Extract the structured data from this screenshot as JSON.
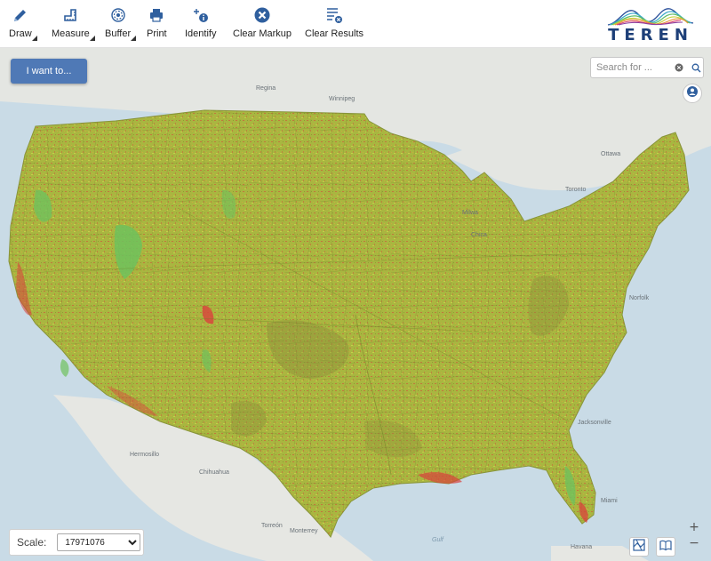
{
  "toolbar": {
    "draw": "Draw",
    "measure": "Measure",
    "buffer": "Buffer",
    "print": "Print",
    "identify": "Identify",
    "clear_markup": "Clear Markup",
    "clear_results": "Clear Results"
  },
  "logo": {
    "text": "TEREN"
  },
  "i_want_to": "I want to...",
  "search": {
    "placeholder": "Search for ..."
  },
  "scale": {
    "label": "Scale:",
    "value": "17971076"
  },
  "zoom": {
    "in": "+",
    "out": "−"
  },
  "map_labels": {
    "regina": "Regina",
    "winnipeg": "Winnipeg",
    "ottawa": "Ottawa",
    "toronto": "Toronto",
    "milwaukee": "Milwa",
    "chicago": "Chica",
    "norfolk": "Norfolk",
    "jacksonville": "Jacksonville",
    "miami": "Miami",
    "hermosillo": "Hermosillo",
    "chihuahua": "Chihuahua",
    "torreon": "Torreón",
    "monterrey": "Monterrey",
    "havana": "Havana",
    "gulf": "Gulf"
  },
  "colors": {
    "toolbar_icon": "#2f5f9e",
    "button": "#4f79b6",
    "land_fill": "#a9b640",
    "hotspot": "#d9423c",
    "water": "#c9dbe6"
  },
  "icons": [
    "pencil-icon",
    "ruler-icon",
    "buffer-icon",
    "printer-icon",
    "identify-icon",
    "clear-markup-icon",
    "clear-results-icon",
    "close-circle-icon",
    "search-icon",
    "locate-user-icon",
    "basemap-icon",
    "bookmark-icon",
    "dropdown-caret-icon"
  ]
}
